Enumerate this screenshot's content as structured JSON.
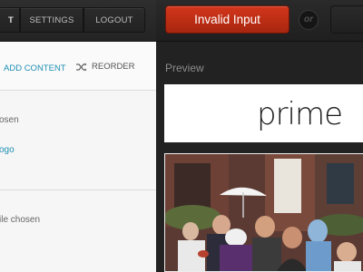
{
  "nav": {
    "partial_label": "T",
    "settings": "SETTINGS",
    "logout": "LOGOUT"
  },
  "toolbar": {
    "add_content": "ADD CONTENT",
    "reorder": "REORDER"
  },
  "editor": {
    "line1": "osen",
    "line2": "ogo",
    "line3": "ile chosen"
  },
  "actions": {
    "invalid_input": "Invalid Input",
    "or": "or"
  },
  "preview": {
    "label": "Preview",
    "logo_text": "prime"
  },
  "colors": {
    "accent": "#1e8fb3",
    "error_button": "#c3311a",
    "logo_accent": "#1ba6d6"
  },
  "icons": [
    "shuffle-icon"
  ]
}
